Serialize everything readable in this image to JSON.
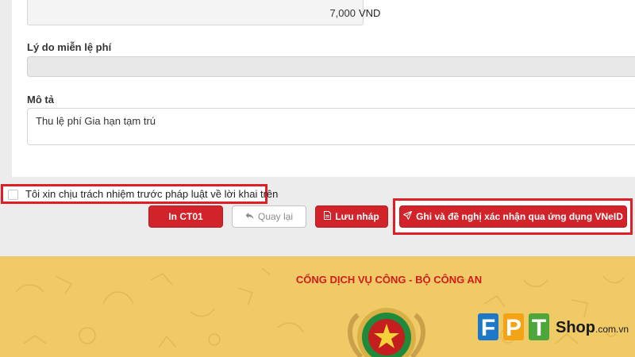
{
  "form": {
    "fee_value": "7,000",
    "fee_unit": "VND",
    "reason_label": "Lý do miễn lệ phí",
    "reason_value": "",
    "description_label": "Mô tả",
    "description_value": "Thu lệ phí Gia hạn tạm trú"
  },
  "confirm": {
    "text": "Tôi xin chịu trách nhiệm trước pháp luật về lời khai trên",
    "checked": false
  },
  "actions": {
    "print_label": "In CT01",
    "back_label": "Quay lại",
    "save_draft_label": "Lưu nháp",
    "submit_label": "Ghi và đề nghị xác nhận qua ứng dụng VNeID"
  },
  "footer": {
    "portal_title": "CỔNG DỊCH VỤ CÔNG - BỘ CÔNG AN",
    "watermark_brand": "FPT Shop.com.vn"
  },
  "colors": {
    "primary_red": "#d2232a",
    "highlight_red": "#e01e26",
    "footer_gold": "#f0ca67"
  },
  "icons": {
    "back": "undo-arrow-icon",
    "save_draft": "document-icon",
    "submit": "paper-plane-icon",
    "emblem": "police-emblem-icon"
  }
}
